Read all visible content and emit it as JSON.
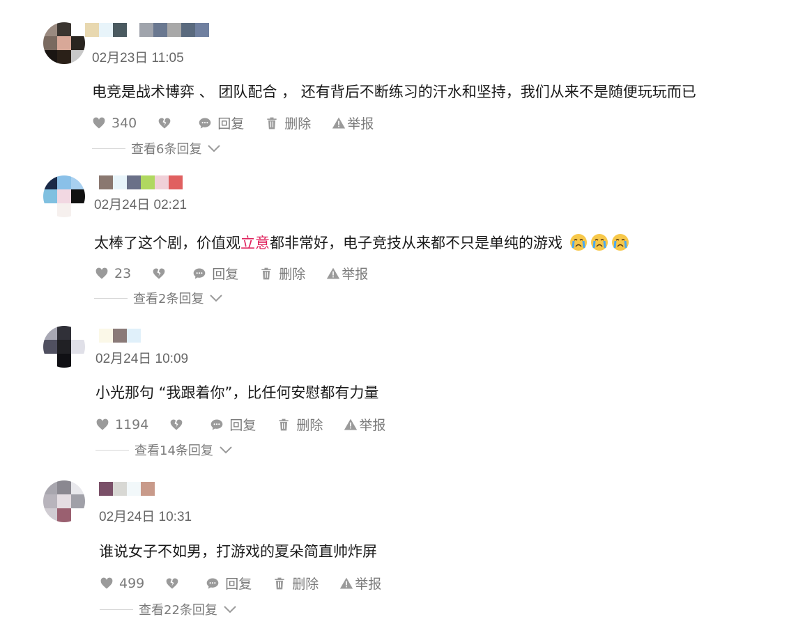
{
  "actions": {
    "reply": "回复",
    "delete": "删除",
    "report": "举报"
  },
  "comments": [
    {
      "time": "02月23日 11:05",
      "text": "电竞是战术博弈 、 团队配合 ，  还有背后不断练习的汗水和坚持，我们从来不是随便玩玩而已",
      "likes": "340",
      "view_replies": "查看6条回复"
    },
    {
      "time": "02月24日 02:21",
      "text_before": "太棒了这个剧，价值观",
      "text_highlight": "立意",
      "text_after": "都非常好，电子竞技从来都不只是单纯的游戏",
      "emoji": "crying-face",
      "likes": "23",
      "view_replies": "查看2条回复"
    },
    {
      "time": "02月24日 10:09",
      "text": "小光那句 “我跟着你”，比任何安慰都有力量",
      "likes": "1194",
      "view_replies": "查看14条回复"
    },
    {
      "time": "02月24日 10:31",
      "text": "谁说女子不如男，打游戏的夏朵简直帅炸屏",
      "likes": "499",
      "view_replies": "查看22条回复"
    }
  ],
  "colors": {
    "highlight": "#e0245e",
    "meta_text": "#7a7a7a",
    "icon": "#9a9a9a"
  }
}
